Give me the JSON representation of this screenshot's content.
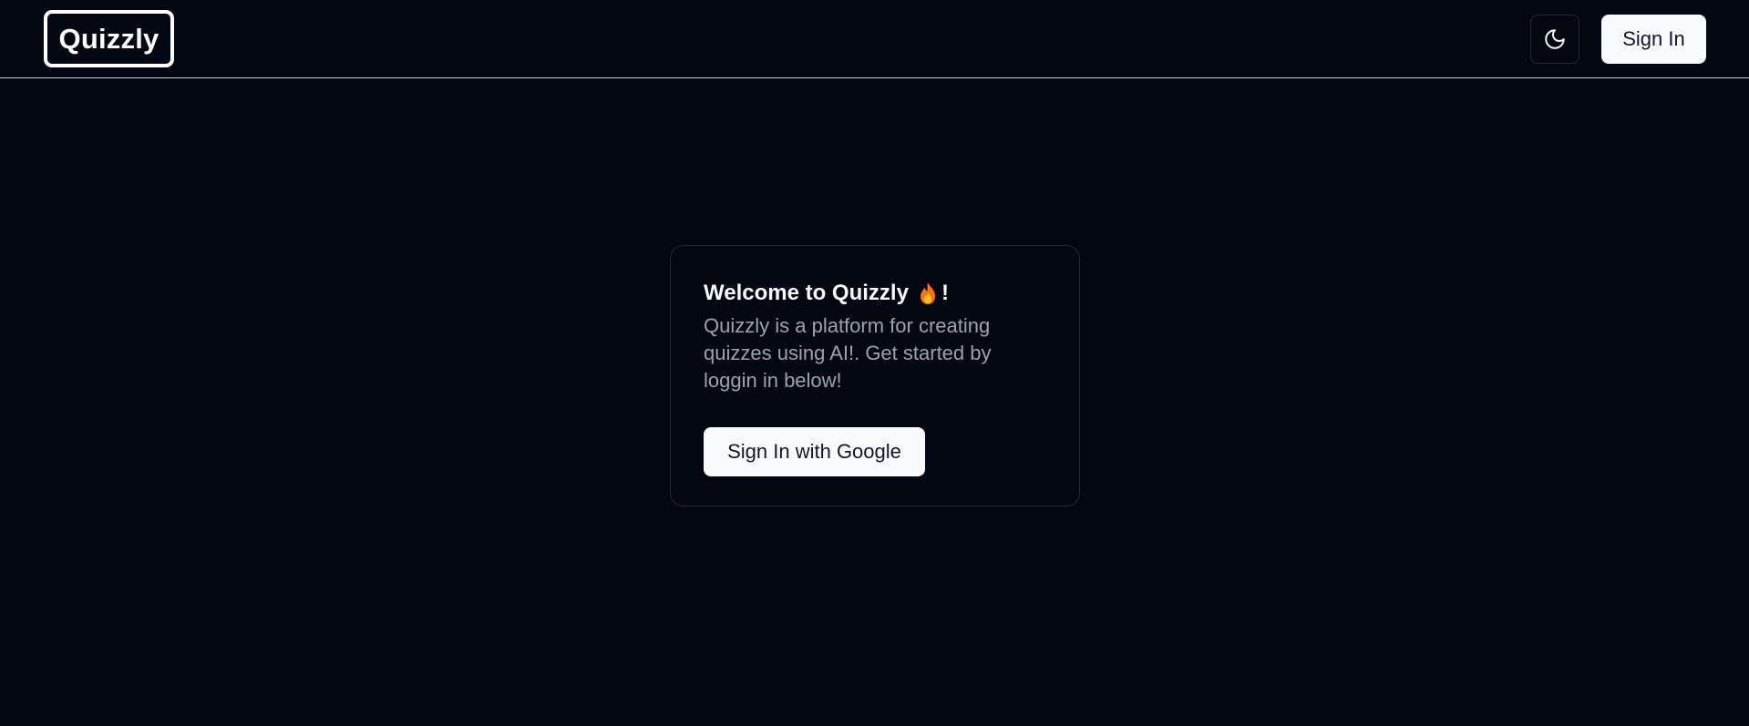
{
  "header": {
    "logo_text": "Quizzly",
    "theme_toggle_icon": "moon-icon",
    "signin_label": "Sign In"
  },
  "card": {
    "title_prefix": "Welcome to Quizzly",
    "title_icon": "fire-emoji-icon",
    "title_suffix": "!",
    "description": "Quizzly is a platform for creating quizzes using AI!. Get started by loggin in below!",
    "google_button_label": "Sign In with Google"
  },
  "colors": {
    "background": "#030712",
    "border": "#1f2937",
    "button_bg": "#f8fafc",
    "button_text": "#0f172a",
    "muted_text": "#9ca3af"
  }
}
